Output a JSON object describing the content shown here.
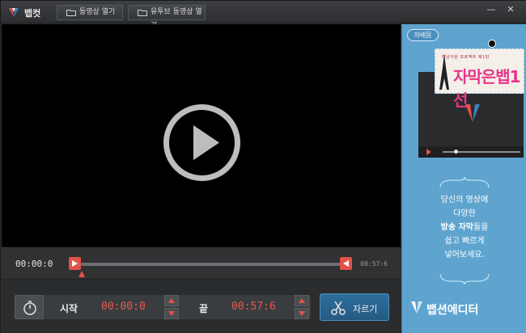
{
  "app": {
    "title": "뱁컷"
  },
  "toolbar": {
    "open_video": "동영상 열기",
    "open_youtube": "유투브 동영상 열기"
  },
  "window": {
    "minimize": "—",
    "close": "✕"
  },
  "player": {
    "play_icon": "play-icon"
  },
  "timeline": {
    "current_time": "00:00:0",
    "end_time": "00:57:6"
  },
  "controls": {
    "start_label": "시작",
    "start_time": "00:00:0",
    "end_label": "끝",
    "end_time": "00:57:6",
    "cut_label": "자르기"
  },
  "ad": {
    "pill": "자배몸",
    "sub_small": "해남어원 프로젝트 제1탄",
    "sub_big": "자막은뱁1선",
    "lines": [
      "당신의 영상에",
      "다양한",
      "방송 자막들을",
      "쉽고 빠르게",
      "넣어보세요."
    ],
    "line3_bold": "방송 자막",
    "line3_rest": "들을",
    "brand": "뱁션에디터"
  },
  "colors": {
    "accent_red": "#e2524a",
    "accent_blue": "#2f6f9c",
    "ad_blue": "#5ea4cf"
  }
}
